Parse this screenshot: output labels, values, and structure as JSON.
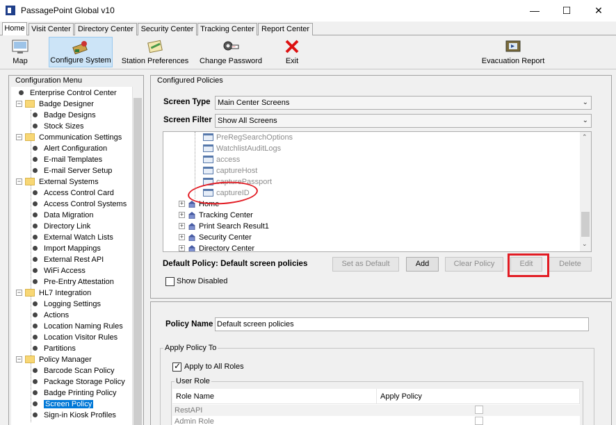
{
  "window": {
    "title": "PassagePoint Global v10",
    "minimize_glyph": "—",
    "maximize_glyph": "☐",
    "close_glyph": "✕"
  },
  "tabs": [
    "Home",
    "Visit Center",
    "Directory Center",
    "Security Center",
    "Tracking Center",
    "Report Center"
  ],
  "toolbar": {
    "map": "Map",
    "configure_system": "Configure System",
    "station_preferences": "Station Preferences",
    "change_password": "Change Password",
    "exit": "Exit",
    "evacuation_report": "Evacuation Report"
  },
  "config_menu": {
    "title": "Configuration Menu",
    "items": [
      {
        "label": "Enterprise Control Center",
        "kind": "leaf",
        "level": 0
      },
      {
        "label": "Badge Designer",
        "kind": "folder",
        "level": 0
      },
      {
        "label": "Badge Designs",
        "kind": "leaf",
        "level": 1
      },
      {
        "label": "Stock Sizes",
        "kind": "leaf",
        "level": 1
      },
      {
        "label": "Communication Settings",
        "kind": "folder",
        "level": 0
      },
      {
        "label": "Alert Configuration",
        "kind": "leaf",
        "level": 1
      },
      {
        "label": "E-mail Templates",
        "kind": "leaf",
        "level": 1
      },
      {
        "label": "E-mail Server Setup",
        "kind": "leaf",
        "level": 1
      },
      {
        "label": "External Systems",
        "kind": "folder",
        "level": 0
      },
      {
        "label": "Access Control Card",
        "kind": "leaf",
        "level": 1
      },
      {
        "label": "Access Control Systems",
        "kind": "leaf",
        "level": 1
      },
      {
        "label": "Data Migration",
        "kind": "leaf",
        "level": 1
      },
      {
        "label": "Directory Link",
        "kind": "leaf",
        "level": 1
      },
      {
        "label": "External Watch Lists",
        "kind": "leaf",
        "level": 1
      },
      {
        "label": "Import Mappings",
        "kind": "leaf",
        "level": 1
      },
      {
        "label": "External Rest API",
        "kind": "leaf",
        "level": 1
      },
      {
        "label": "WiFi Access",
        "kind": "leaf",
        "level": 1
      },
      {
        "label": "Pre-Entry Attestation",
        "kind": "leaf",
        "level": 1
      },
      {
        "label": "HL7 Integration",
        "kind": "folder",
        "level": 0
      },
      {
        "label": "Logging Settings",
        "kind": "leaf",
        "level": 1
      },
      {
        "label": "Actions",
        "kind": "leaf",
        "level": 1
      },
      {
        "label": "Location Naming Rules",
        "kind": "leaf",
        "level": 1
      },
      {
        "label": "Location Visitor Rules",
        "kind": "leaf",
        "level": 1
      },
      {
        "label": "Partitions",
        "kind": "leaf",
        "level": 1
      },
      {
        "label": "Policy Manager",
        "kind": "folder",
        "level": 0
      },
      {
        "label": "Barcode Scan Policy",
        "kind": "leaf",
        "level": 1
      },
      {
        "label": "Package Storage Policy",
        "kind": "leaf",
        "level": 1
      },
      {
        "label": "Badge Printing Policy",
        "kind": "leaf",
        "level": 1
      },
      {
        "label": "Screen Policy",
        "kind": "leaf",
        "level": 1,
        "selected": true
      },
      {
        "label": "Sign-in Kiosk Profiles",
        "kind": "leaf",
        "level": 1
      }
    ]
  },
  "configured_policies": {
    "title": "Configured Policies",
    "screen_type_label": "Screen Type",
    "screen_type_value": "Main Center Screens",
    "screen_filter_label": "Screen Filter",
    "screen_filter_value": "Show All Screens",
    "tree": [
      {
        "label": "PreRegSearchOptions",
        "kind": "screen",
        "disabled": true
      },
      {
        "label": "WatchlistAuditLogs",
        "kind": "screen",
        "disabled": true
      },
      {
        "label": "access",
        "kind": "screen",
        "disabled": true
      },
      {
        "label": "captureHost",
        "kind": "screen",
        "disabled": true
      },
      {
        "label": "capturePassport",
        "kind": "screen",
        "disabled": true
      },
      {
        "label": "captureID",
        "kind": "screen",
        "disabled": true
      },
      {
        "label": "Home",
        "kind": "center",
        "disabled": false
      },
      {
        "label": "Tracking Center",
        "kind": "center",
        "disabled": false
      },
      {
        "label": "Print Search Result1",
        "kind": "center",
        "disabled": false
      },
      {
        "label": "Security Center",
        "kind": "center",
        "disabled": false
      },
      {
        "label": "Directory Center",
        "kind": "center",
        "disabled": false
      }
    ],
    "default_policy_text": "Default Policy: Default screen policies",
    "buttons": {
      "set_as_default": "Set as Default",
      "add": "Add",
      "clear_policy": "Clear Policy",
      "edit": "Edit",
      "delete": "Delete"
    },
    "show_disabled_label": "Show Disabled",
    "show_disabled_checked": false
  },
  "policy_editor": {
    "policy_name_label": "Policy Name",
    "policy_name_value": "Default screen policies",
    "apply_policy_to_label": "Apply Policy To",
    "apply_all_roles_label": "Apply to All Roles",
    "apply_all_roles_checked": true,
    "user_role_label": "User Role",
    "table": {
      "columns": [
        "Role Name",
        "Apply Policy"
      ],
      "rows": [
        {
          "role": "RestAPI",
          "apply": false
        },
        {
          "role": "Admin Role",
          "apply": false
        }
      ]
    }
  },
  "colors": {
    "annotation_red": "#e21b23",
    "selection_blue": "#0078d7"
  }
}
